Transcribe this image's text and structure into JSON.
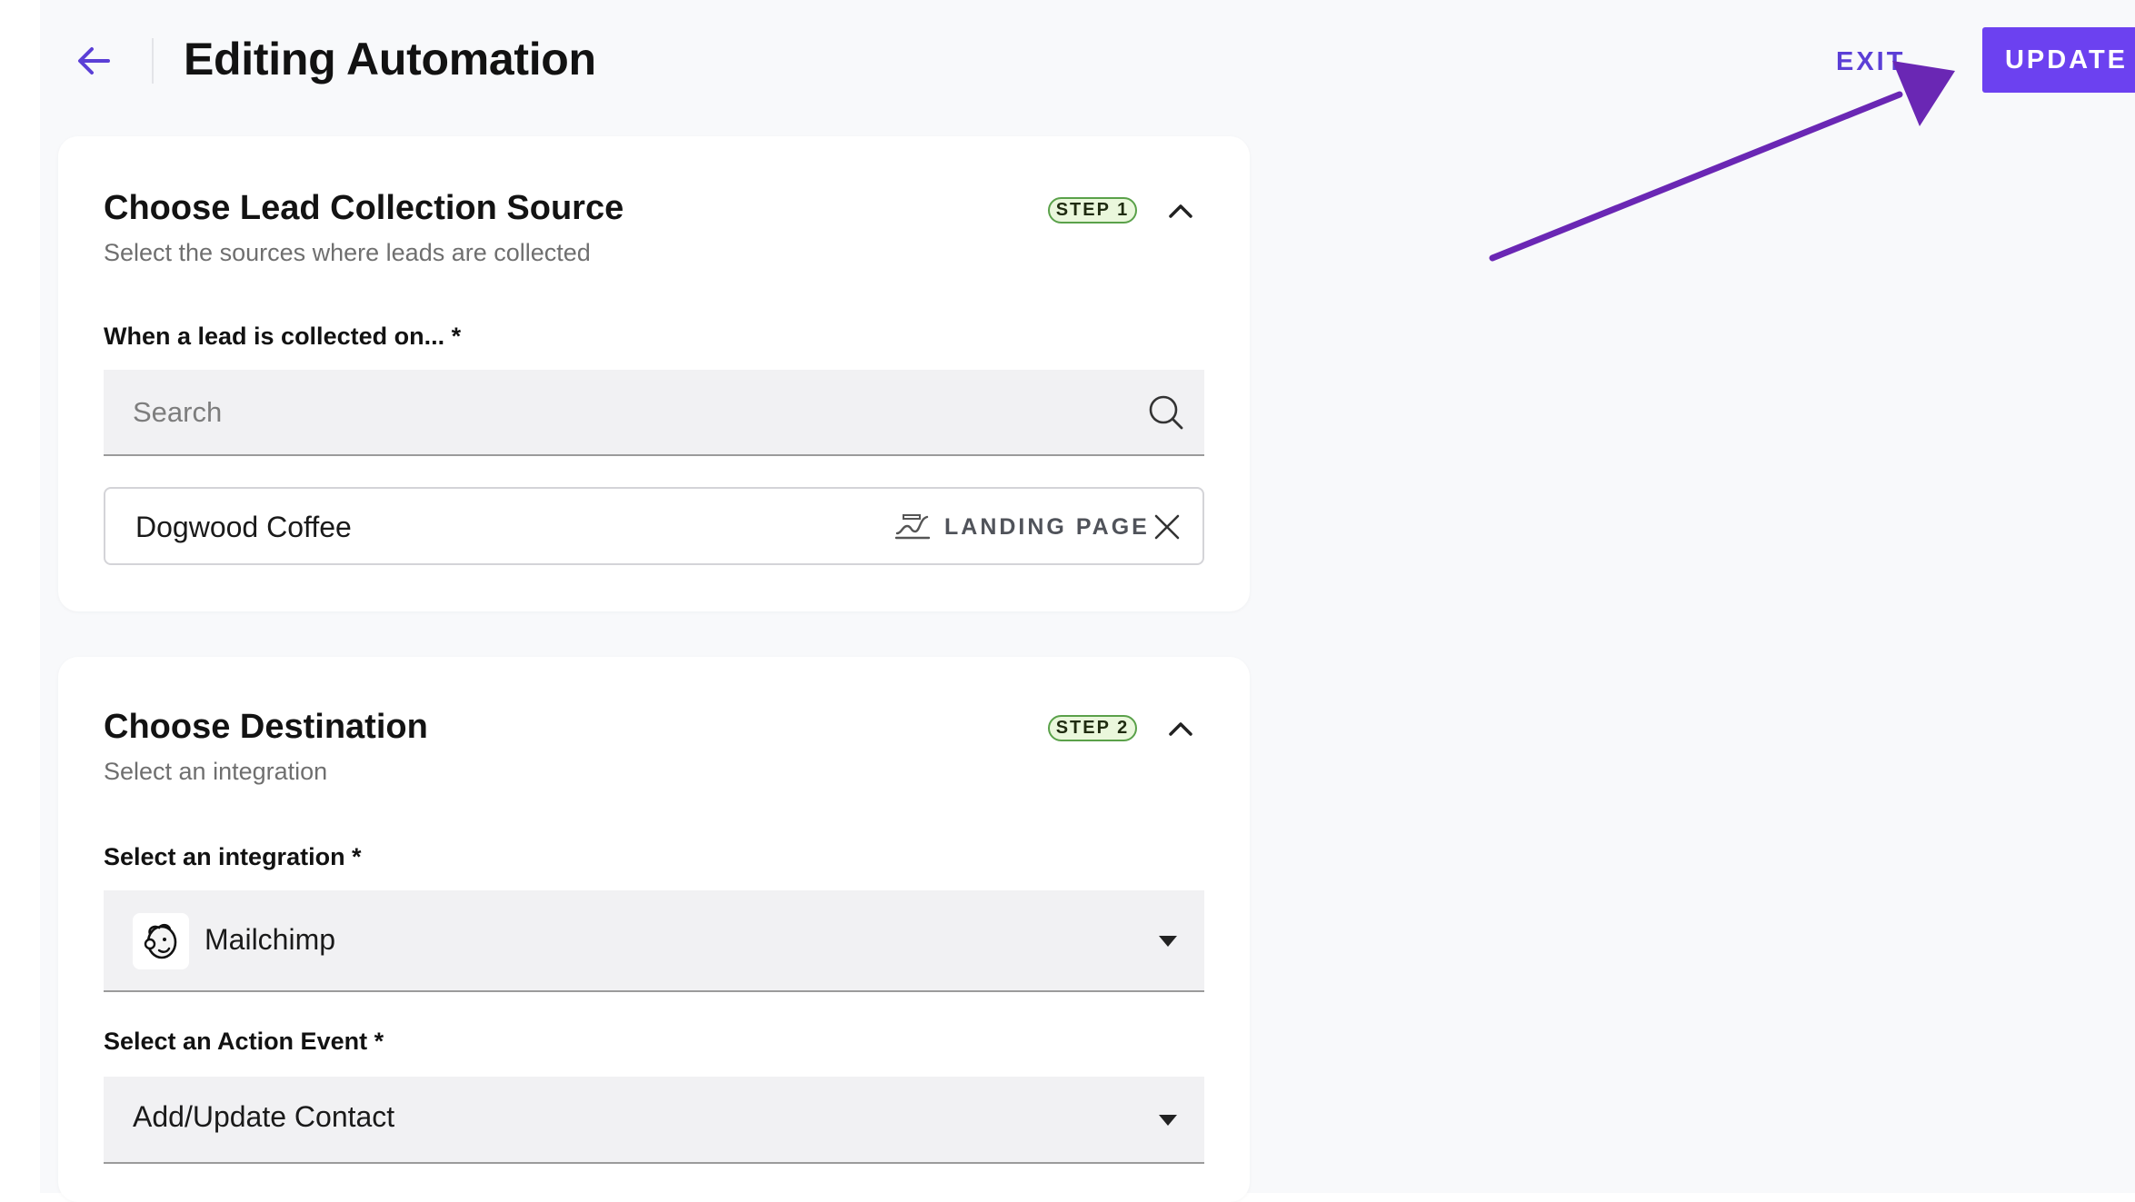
{
  "header": {
    "title": "Editing Automation",
    "exit_label": "EXIT",
    "update_label": "UPDATE"
  },
  "step1": {
    "title": "Choose Lead Collection Source",
    "subtitle": "Select the sources where leads are collected",
    "badge": "STEP 1",
    "field_label": "When a lead is collected on... *",
    "search_placeholder": "Search",
    "selected_source": {
      "name": "Dogwood Coffee",
      "type": "LANDING PAGE",
      "icon": "landing-page-icon"
    }
  },
  "step2": {
    "title": "Choose Destination",
    "subtitle": "Select an integration",
    "badge": "STEP 2",
    "integration_label": "Select an integration *",
    "integration_value": "Mailchimp",
    "integration_icon": "mailchimp-logo-icon",
    "action_label": "Select an Action Event *",
    "action_value": "Add/Update Contact"
  },
  "colors": {
    "accent": "#6c41f0",
    "annotation_arrow": "#6a27b4",
    "badge_border": "#5aa14a",
    "badge_bg": "#eaf7dc"
  }
}
